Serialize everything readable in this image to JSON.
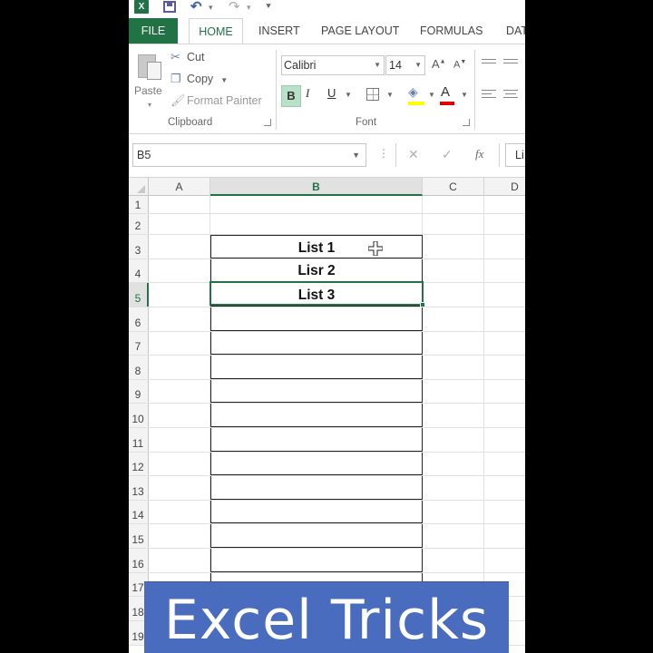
{
  "qat": {
    "app_icon": "X"
  },
  "tabs": [
    {
      "label": "FILE"
    },
    {
      "label": "HOME"
    },
    {
      "label": "INSERT"
    },
    {
      "label": "PAGE LAYOUT"
    },
    {
      "label": "FORMULAS"
    },
    {
      "label": "DAT"
    }
  ],
  "ribbon": {
    "clipboard": {
      "paste_label": "Paste",
      "cut_label": "Cut",
      "copy_label": "Copy",
      "format_painter_label": "Format Painter",
      "group_label": "Clipboard"
    },
    "font": {
      "font_name": "Calibri",
      "font_size": "14",
      "bold": "B",
      "italic": "I",
      "underline": "U",
      "font_color_glyph": "A",
      "group_label": "Font",
      "bold_active": true
    }
  },
  "formula_bar": {
    "name_box": "B5",
    "fx": "fx",
    "content": "Li"
  },
  "grid": {
    "columns": [
      "A",
      "B",
      "C",
      "D"
    ],
    "selected_column": "B",
    "active_cell": "B5",
    "rows": [
      {
        "num": "1",
        "b": ""
      },
      {
        "num": "2",
        "b": ""
      },
      {
        "num": "3",
        "b": "List 1"
      },
      {
        "num": "4",
        "b": "Lisr 2"
      },
      {
        "num": "5",
        "b": "List 3"
      },
      {
        "num": "6",
        "b": ""
      },
      {
        "num": "7",
        "b": ""
      },
      {
        "num": "8",
        "b": ""
      },
      {
        "num": "9",
        "b": ""
      },
      {
        "num": "10",
        "b": ""
      },
      {
        "num": "11",
        "b": ""
      },
      {
        "num": "12",
        "b": ""
      },
      {
        "num": "13",
        "b": ""
      },
      {
        "num": "14",
        "b": ""
      },
      {
        "num": "15",
        "b": ""
      },
      {
        "num": "16",
        "b": ""
      },
      {
        "num": "17",
        "b": ""
      },
      {
        "num": "18",
        "b": ""
      },
      {
        "num": "19",
        "b": ""
      }
    ]
  },
  "banner": {
    "text": "Excel Tricks"
  },
  "colors": {
    "excel_green": "#217346",
    "banner_blue": "#4a6cbf",
    "font_color": "#e00000",
    "fill_color": "#ffff00"
  }
}
